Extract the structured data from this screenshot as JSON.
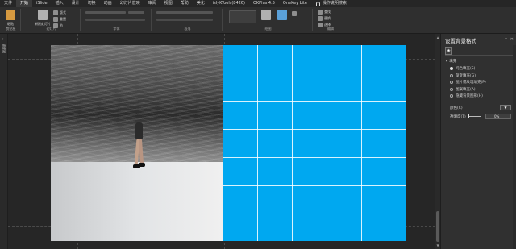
{
  "ribbon_tabs": [
    {
      "label": "文件",
      "active": false
    },
    {
      "label": "开始",
      "active": true
    },
    {
      "label": "iSlide",
      "active": false
    },
    {
      "label": "插入",
      "active": false
    },
    {
      "label": "设计",
      "active": false
    },
    {
      "label": "切换",
      "active": false
    },
    {
      "label": "动画",
      "active": false
    },
    {
      "label": "幻灯片放映",
      "active": false
    },
    {
      "label": "审阅",
      "active": false
    },
    {
      "label": "视图",
      "active": false
    },
    {
      "label": "帮助",
      "active": false
    },
    {
      "label": "美化",
      "active": false
    },
    {
      "label": "islyKTools(8426)",
      "active": false
    },
    {
      "label": "OKPlus 4.5",
      "active": false
    },
    {
      "label": "OneKey Lite",
      "active": false
    }
  ],
  "tell_me": "操作说明搜索",
  "ribbon": {
    "clipboard": {
      "btn": "粘贴",
      "label": "剪贴板"
    },
    "slides": {
      "btn": "新建幻灯片",
      "small1": "版式",
      "small2": "重置",
      "small3": "节",
      "label": "幻灯片"
    },
    "font": {
      "label": "字体"
    },
    "paragraph": {
      "label": "段落"
    },
    "drawing": {
      "label": "绘图"
    },
    "editing": {
      "find": "查找",
      "replace": "替换",
      "select": "选择",
      "label": "编辑"
    }
  },
  "thumbnail_label": "缩略图",
  "format_pane": {
    "title": "设置背景格式",
    "section": "填充",
    "options": [
      {
        "label": "纯色填充(S)",
        "selected": true
      },
      {
        "label": "渐变填充(G)",
        "selected": false
      },
      {
        "label": "图片或纹理填充(P)",
        "selected": false
      },
      {
        "label": "图案填充(A)",
        "selected": false
      },
      {
        "label": "隐藏背景图形(H)",
        "selected": false
      }
    ],
    "color_label": "颜色(C)",
    "transparency_label": "透明度(T)",
    "transparency_value": "0%"
  },
  "colors": {
    "grid_panel": "#00a8f0",
    "ribbon": "#2f2f2f",
    "pane": "#303030"
  }
}
